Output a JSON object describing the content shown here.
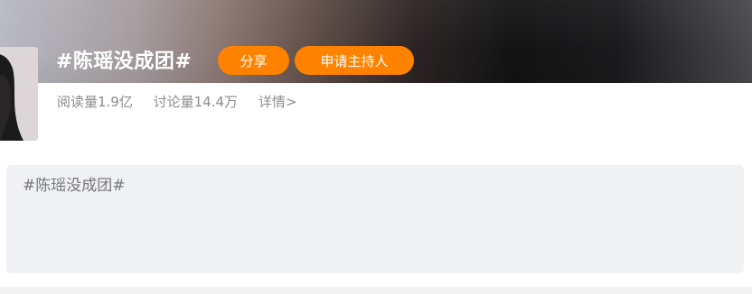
{
  "topic": {
    "title": "#陈瑶没成团#"
  },
  "actions": {
    "share_label": "分享",
    "apply_host_label": "申请主持人"
  },
  "stats": {
    "reads": "阅读量1.9亿",
    "discussions": "讨论量14.4万",
    "details": "详情>"
  },
  "composer": {
    "prefill": "#陈瑶没成团#"
  },
  "colors": {
    "accent": "#ff8200",
    "muted_text": "#8c8c8c",
    "composer_bg": "#f0f1f4"
  },
  "icons": {
    "avatar": "avatar-image"
  }
}
